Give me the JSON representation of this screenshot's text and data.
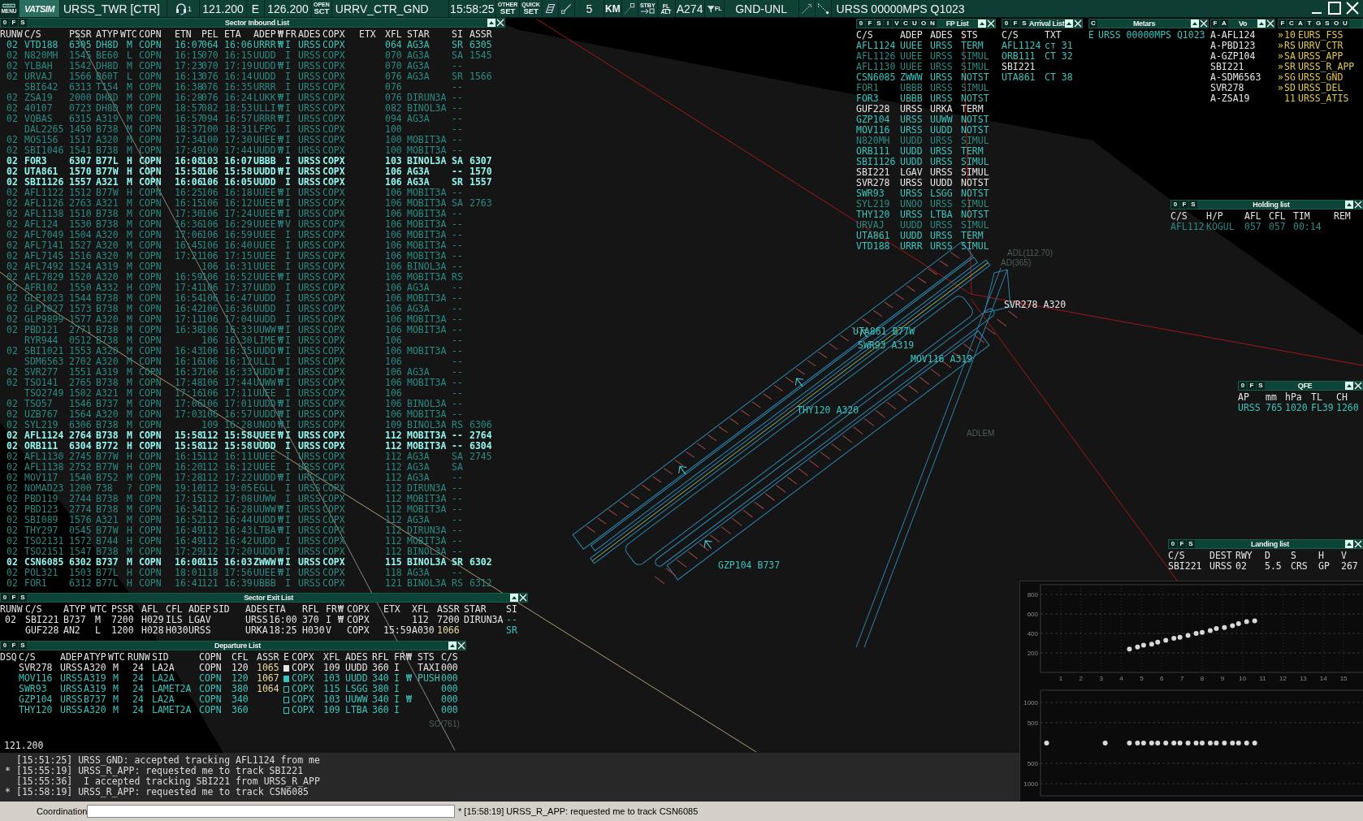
{
  "top_bar": {
    "menu_label": "MENU",
    "logo": "VATSIM",
    "station": "URSS_TWR [CTR]",
    "headset_count": "1",
    "primary_frequency": "121.200",
    "atis_letter": "E",
    "secondary_frequency": "126.200",
    "open_label": "OPEN",
    "sct_label": "SCT",
    "sector": "URRV_CTR_GND",
    "time": "15:58:25",
    "other_label": "OTHER",
    "other_set": "SET",
    "quick_label": "QUICK",
    "quick_set": "SET",
    "range": "5",
    "unit": "KM",
    "stby_label": "STBY",
    "fl_label": "FL",
    "alt_label": "ALT",
    "transition": "A274",
    "filter_label": "FL",
    "altitude_filter": "GND-UNL",
    "metar": "URSS 00000MPS Q1023"
  },
  "inbound_list": {
    "buttons": [
      "0",
      "F",
      "S"
    ],
    "title": "Sector Inbound List",
    "columns": [
      "RUNW",
      "C/S",
      "PSSR",
      "ATYP",
      "WTC",
      "COPN",
      "ETN",
      "PEL",
      "ETA",
      "ADEP",
      "₩",
      "FR",
      "ADES",
      "COPX",
      "ETX",
      "XFL",
      "STAR",
      "SI",
      "ASSR"
    ],
    "rows": [
      {
        "kind": "notified",
        "cells": [
          "02",
          "VTD188",
          "6305",
          "DH8D",
          "M",
          "COPN",
          "16:07",
          "064",
          "16:06",
          "URRR",
          "₩",
          "I",
          "URSS",
          "COPX",
          null,
          "064",
          "AG3A",
          "SR",
          "6305"
        ]
      },
      {
        "kind": "other",
        "cells": [
          "02",
          "N820MH",
          "1545",
          "BE60",
          "L",
          "COPN",
          "16:15",
          "070",
          "16:15",
          "UUDD",
          null,
          "I",
          "URSS",
          "COPX",
          null,
          "070",
          "AG3A",
          "SA",
          "1545"
        ]
      },
      {
        "kind": "other",
        "cells": [
          "02",
          "YLBAH",
          "1542",
          "DH8D",
          "M",
          "COPN",
          "17:23",
          "070",
          "17:19",
          "UUDD",
          "₩",
          "I",
          "URSS",
          "COPX",
          null,
          "070",
          "AG3A",
          "--",
          null
        ]
      },
      {
        "kind": "other",
        "cells": [
          "02",
          "URVAJ",
          "1566",
          "B60T",
          "L",
          "COPN",
          "16:13",
          "076",
          "16:14",
          "UUDD",
          null,
          "I",
          "URSS",
          "COPX",
          null,
          "076",
          "AG3A",
          "SR",
          "1566"
        ]
      },
      {
        "kind": "other",
        "cells": [
          null,
          "SBI642",
          "6313",
          "T154",
          "M",
          "COPN",
          "16:38",
          "076",
          "16:35",
          "URRR",
          null,
          "I",
          "URSS",
          "COPX",
          null,
          "076",
          null,
          "--",
          null
        ]
      },
      {
        "kind": "other",
        "cells": [
          "02",
          "ZSA19",
          "2000",
          "DH8D",
          "M",
          "COPN",
          "16:28",
          "076",
          "16:24",
          "LUKK",
          "₩",
          "I",
          "URSS",
          "COPX",
          null,
          "076",
          "DIRUN3A",
          "--",
          null
        ]
      },
      {
        "kind": "other",
        "cells": [
          "02",
          "40107",
          "0723",
          "DH8D",
          "M",
          "COPN",
          "18:57",
          "082",
          "18:53",
          "ULLI",
          "₩",
          "I",
          "URSS",
          "COPX",
          null,
          "082",
          "BINOL3A",
          "--",
          null
        ]
      },
      {
        "kind": "other",
        "cells": [
          "02",
          "VQBAS",
          "6315",
          "A319",
          "M",
          "COPN",
          "16:57",
          "094",
          "16:57",
          "URRR",
          "₩",
          "I",
          "URSS",
          "COPX",
          null,
          "094",
          "AG3A",
          "--",
          null
        ]
      },
      {
        "kind": "other",
        "cells": [
          null,
          "DAL2265",
          "1450",
          "B738",
          "M",
          "COPN",
          "18:37",
          "100",
          "18:31",
          "LFPG",
          null,
          "I",
          "URSS",
          "COPX",
          null,
          "100",
          null,
          "--",
          null
        ]
      },
      {
        "kind": "other",
        "cells": [
          "02",
          "MOS156",
          "1517",
          "A320",
          "M",
          "COPN",
          "17:34",
          "100",
          "17:30",
          "UUEE",
          "₩",
          "I",
          "URSS",
          "COPX",
          null,
          "100",
          "MOBIT3A",
          "--",
          null
        ]
      },
      {
        "kind": "other",
        "cells": [
          "02",
          "SBI1046",
          "1541",
          "B738",
          "M",
          "COPN",
          "17:49",
          "100",
          "17:44",
          "UUDD",
          "₩",
          "I",
          "URSS",
          "COPX",
          null,
          "100",
          "MOBIT3A",
          "--",
          null
        ]
      },
      {
        "kind": "assumed",
        "cells": [
          "02",
          "FOR3",
          "6307",
          "B77L",
          "H",
          "COPN",
          "16:08",
          "103",
          "16:07",
          "UBBB",
          null,
          "I",
          "URSS",
          "COPX",
          null,
          "103",
          "BINOL3A",
          "SA",
          "6307"
        ]
      },
      {
        "kind": "assumed",
        "cells": [
          "02",
          "UTA861",
          "1570",
          "B77W",
          "H",
          "COPN",
          "15:58",
          "106",
          "15:58",
          "UUDD",
          "₩",
          "I",
          "URSS",
          "COPX",
          null,
          "106",
          "AG3A",
          "--",
          "1570"
        ]
      },
      {
        "kind": "assumed",
        "cells": [
          "02",
          "SBI1126",
          "1557",
          "A321",
          "M",
          "COPN",
          "16:06",
          "106",
          "16:05",
          "UUDD",
          null,
          "I",
          "URSS",
          "COPX",
          null,
          "106",
          "AG3A",
          "SR",
          "1557"
        ]
      },
      {
        "kind": "other",
        "cells": [
          "02",
          "AFL1122",
          "1512",
          "B77W",
          "H",
          "COPN",
          "16:25",
          "106",
          "16:18",
          "UUEE",
          "₩",
          "I",
          "URSS",
          "COPX",
          null,
          "106",
          "MOBIT3A",
          "--",
          null
        ]
      },
      {
        "kind": "other",
        "cells": [
          "02",
          "AFL1126",
          "2763",
          "A321",
          "M",
          "COPN",
          "16:15",
          "106",
          "16:12",
          "UUEE",
          "₩",
          "I",
          "URSS",
          "COPX",
          null,
          "106",
          "MOBIT3A",
          "SA",
          "2763"
        ]
      },
      {
        "kind": "other",
        "cells": [
          "02",
          "AFL1138",
          "1510",
          "B738",
          "M",
          "COPN",
          "17:30",
          "106",
          "17:24",
          "UUEE",
          "₩",
          "I",
          "URSS",
          "COPX",
          null,
          "106",
          "MOBIT3A",
          "--",
          null
        ]
      },
      {
        "kind": "other",
        "cells": [
          "02",
          "AFL124",
          "1530",
          "B738",
          "M",
          "COPN",
          "16:36",
          "106",
          "16:29",
          "UUEE",
          "₩",
          "V",
          "URSS",
          "COPX",
          null,
          "106",
          "MOBIT3A",
          "--",
          null
        ]
      },
      {
        "kind": "other",
        "cells": [
          "02",
          "AFL7049",
          "1504",
          "A320",
          "M",
          "COPN",
          "17:06",
          "106",
          "16:59",
          "UUEE",
          null,
          "I",
          "URSS",
          "COPX",
          null,
          "106",
          "MOBIT3A",
          "--",
          null
        ]
      },
      {
        "kind": "other",
        "cells": [
          "02",
          "AFL7141",
          "1527",
          "A320",
          "M",
          "COPN",
          "16:45",
          "106",
          "16:40",
          "UUEE",
          null,
          "I",
          "URSS",
          "COPX",
          null,
          "106",
          "MOBIT3A",
          "--",
          null
        ]
      },
      {
        "kind": "other",
        "cells": [
          "02",
          "AFL7145",
          "1516",
          "A320",
          "M",
          "COPN",
          "17:21",
          "106",
          "17:15",
          "UUEE",
          null,
          "I",
          "URSS",
          "COPX",
          null,
          "106",
          "MOBIT3A",
          "--",
          null
        ]
      },
      {
        "kind": "other",
        "cells": [
          "02",
          "AFL7492",
          "1524",
          "A319",
          "M",
          "COPN",
          null,
          "106",
          "16:31",
          "UUEE",
          null,
          "I",
          "URSS",
          "COPX",
          null,
          "106",
          "BINOL3A",
          "--",
          null
        ]
      },
      {
        "kind": "other",
        "cells": [
          "02",
          "AFL7829",
          "1520",
          "A320",
          "M",
          "COPN",
          "16:59",
          "106",
          "16:52",
          "UUEE",
          "₩",
          "I",
          "URSS",
          "COPX",
          null,
          "106",
          "MOBIT3A",
          "RS",
          null
        ]
      },
      {
        "kind": "other",
        "cells": [
          "02",
          "AFR102",
          "1550",
          "A332",
          "H",
          "COPN",
          "17:41",
          "106",
          "17:37",
          "UUDD",
          null,
          "I",
          "URSS",
          "COPX",
          null,
          "106",
          "AG3A",
          "--",
          null
        ]
      },
      {
        "kind": "other",
        "cells": [
          "02",
          "GLP1023",
          "1544",
          "B738",
          "M",
          "COPN",
          "16:54",
          "106",
          "16:47",
          "UUDD",
          null,
          "I",
          "URSS",
          "COPX",
          null,
          "106",
          "MOBIT3A",
          "--",
          null
        ]
      },
      {
        "kind": "other",
        "cells": [
          "02",
          "GLP1027",
          "1573",
          "B738",
          "M",
          "COPN",
          "16:42",
          "106",
          "16:36",
          "UUDD",
          null,
          "I",
          "URSS",
          "COPX",
          null,
          "106",
          "AG3A",
          "--",
          null
        ]
      },
      {
        "kind": "other",
        "cells": [
          "02",
          "GLP9899",
          "1577",
          "A320",
          "M",
          "COPN",
          "17:11",
          "106",
          "17:04",
          "UUDD",
          null,
          "I",
          "URSS",
          "COPX",
          null,
          "106",
          "MOBIT3A",
          "--",
          null
        ]
      },
      {
        "kind": "other",
        "cells": [
          "02",
          "PBD121",
          "2771",
          "B738",
          "M",
          "COPN",
          "16:38",
          "106",
          "16:33",
          "UUWW",
          "₩",
          "I",
          "URSS",
          "COPX",
          null,
          "106",
          "MOBIT3A",
          "--",
          null
        ]
      },
      {
        "kind": "other",
        "cells": [
          null,
          "RYR944",
          "0512",
          "B738",
          "M",
          "COPN",
          null,
          "106",
          "16:30",
          "LIME",
          "₩",
          "I",
          "URSS",
          "COPX",
          null,
          "106",
          null,
          "--",
          null
        ]
      },
      {
        "kind": "other",
        "cells": [
          "02",
          "SBI1021",
          "1553",
          "A320",
          "M",
          "COPN",
          "16:43",
          "106",
          "16:35",
          "UUDD",
          "₩",
          "I",
          "URSS",
          "COPX",
          null,
          "106",
          "MOBIT3A",
          "--",
          null
        ]
      },
      {
        "kind": "other",
        "cells": [
          null,
          "SDM6563",
          "2702",
          "A320",
          "M",
          "COPN",
          "16:16",
          "106",
          "16:12",
          "ULLI",
          null,
          "I",
          "URSS",
          "COPX",
          null,
          "106",
          null,
          "--",
          null
        ]
      },
      {
        "kind": "other",
        "cells": [
          "02",
          "SVR277",
          "1551",
          "A319",
          "M",
          "COPN",
          "16:37",
          "106",
          "16:33",
          "UUDD",
          "₩",
          "I",
          "URSS",
          "COPX",
          null,
          "106",
          "AG3A",
          "--",
          null
        ]
      },
      {
        "kind": "other",
        "cells": [
          "02",
          "TSO141",
          "2765",
          "B738",
          "M",
          "COPN",
          "17:48",
          "106",
          "17:44",
          "UUWW",
          "₩",
          "I",
          "URSS",
          "COPX",
          null,
          "106",
          "MOBIT3A",
          "--",
          null
        ]
      },
      {
        "kind": "other",
        "cells": [
          null,
          "TSO2749",
          "1502",
          "A321",
          "M",
          "COPN",
          "17:16",
          "106",
          "17:11",
          "UUEE",
          null,
          "I",
          "URSS",
          "COPX",
          null,
          "106",
          null,
          "--",
          null
        ]
      },
      {
        "kind": "other",
        "cells": [
          "02",
          "TSO57",
          "1546",
          "B737",
          "M",
          "COPN",
          "17:06",
          "106",
          "17:01",
          "UUDD",
          "₩",
          "I",
          "URSS",
          "COPX",
          null,
          "106",
          "BINOL3A",
          "--",
          null
        ]
      },
      {
        "kind": "other",
        "cells": [
          "02",
          "UZB767",
          "1564",
          "A320",
          "M",
          "COPN",
          "17:03",
          "106",
          "16:57",
          "UUDD",
          "₩",
          "I",
          "URSS",
          "COPX",
          null,
          "106",
          "MOBIT3A",
          "--",
          null
        ]
      },
      {
        "kind": "other",
        "cells": [
          "02",
          "SYL219",
          "6306",
          "B738",
          "M",
          "COPN",
          null,
          "109",
          "16:28",
          "UNOO",
          "₩",
          "I",
          "URSS",
          "COPX",
          null,
          "109",
          "BINOL3A",
          "RS",
          "6306"
        ]
      },
      {
        "kind": "assumed",
        "cells": [
          "02",
          "AFL1124",
          "2764",
          "B738",
          "M",
          "COPN",
          "15:58",
          "112",
          "15:58",
          "UUEE",
          "₩",
          "I",
          "URSS",
          "COPX",
          null,
          "112",
          "MOBIT3A",
          "--",
          "2764"
        ]
      },
      {
        "kind": "assumed",
        "cells": [
          "02",
          "ORB111",
          "6304",
          "B772",
          "H",
          "COPN",
          "15:58",
          "112",
          "15:58",
          "UUDD",
          null,
          "I",
          "URSS",
          "COPX",
          null,
          "112",
          "MOBIT3A",
          "--",
          "6304"
        ]
      },
      {
        "kind": "other",
        "cells": [
          "02",
          "AFL1130",
          "2745",
          "B77W",
          "H",
          "COPN",
          "16:15",
          "112",
          "16:11",
          "UUEE",
          null,
          "I",
          "URSS",
          "COPX",
          null,
          "112",
          "AG3A",
          "SA",
          "2745"
        ]
      },
      {
        "kind": "other",
        "cells": [
          "02",
          "AFL1138",
          "2752",
          "B77W",
          "H",
          "COPN",
          "16:20",
          "112",
          "16:12",
          "UUEE",
          null,
          "I",
          "URSS",
          "COPX",
          null,
          "112",
          "AG3A",
          "SA",
          null
        ]
      },
      {
        "kind": "other",
        "cells": [
          "02",
          "MOV117",
          "1540",
          "B752",
          "M",
          "COPN",
          "17:28",
          "112",
          "17:22",
          "UUDD",
          "₩",
          "I",
          "URSS",
          "COPX",
          null,
          "112",
          "AG3A",
          "--",
          null
        ]
      },
      {
        "kind": "other",
        "cells": [
          "02",
          "NOMAD23",
          "1200",
          "738",
          "?",
          "COPN",
          "19:10",
          "112",
          "19:05",
          "EGLL",
          null,
          "I",
          "URSS",
          "COPX",
          null,
          "112",
          "DIRUN3A",
          "--",
          null
        ]
      },
      {
        "kind": "other",
        "cells": [
          "02",
          "PBD119",
          "2744",
          "B738",
          "M",
          "COPN",
          "17:15",
          "112",
          "17:08",
          "UUWW",
          null,
          "I",
          "URSS",
          "COPX",
          null,
          "112",
          "MOBIT3A",
          "--",
          null
        ]
      },
      {
        "kind": "other",
        "cells": [
          "02",
          "PBD123",
          "2774",
          "B738",
          "M",
          "COPN",
          "16:34",
          "112",
          "16:28",
          "UUWW",
          "₩",
          "I",
          "URSS",
          "COPX",
          null,
          "112",
          "MOBIT3A",
          "--",
          null
        ]
      },
      {
        "kind": "other",
        "cells": [
          "02",
          "SBI089",
          "1576",
          "A321",
          "M",
          "COPN",
          "16:52",
          "112",
          "16:44",
          "UUDD",
          "₩",
          "I",
          "URSS",
          "COPX",
          null,
          "112",
          "AG3A",
          "--",
          null
        ]
      },
      {
        "kind": "other",
        "cells": [
          "02",
          "THY297",
          "0545",
          "B77W",
          "H",
          "COPN",
          "16:49",
          "112",
          "16:43",
          "LTBA",
          "₩",
          "I",
          "URSS",
          "COPX",
          null,
          "112",
          "DIRUN3A",
          "--",
          null
        ]
      },
      {
        "kind": "other",
        "cells": [
          "02",
          "TSO2131",
          "1572",
          "B744",
          "H",
          "COPN",
          "16:49",
          "112",
          "16:42",
          "UUDD",
          null,
          "I",
          "URSS",
          "COPX",
          null,
          "112",
          "MOBIT3A",
          "--",
          null
        ]
      },
      {
        "kind": "other",
        "cells": [
          "02",
          "TSO2151",
          "1547",
          "B738",
          "M",
          "COPN",
          "17:29",
          "112",
          "17:20",
          "UUDD",
          "₩",
          "I",
          "URSS",
          "COPX",
          null,
          "112",
          "BINOL3A",
          "--",
          null
        ]
      },
      {
        "kind": "assumed",
        "cells": [
          "02",
          "CSN6085",
          "6302",
          "B737",
          "M",
          "COPN",
          "16:00",
          "115",
          "16:03",
          "ZWWW",
          "₩",
          "I",
          "URSS",
          "COPX",
          null,
          "115",
          "BINOL3A",
          "SR",
          "6302"
        ]
      },
      {
        "kind": "other",
        "cells": [
          "02",
          "POL321",
          "1503",
          "B77L",
          "H",
          "COPN",
          "18:01",
          "118",
          "17:56",
          "UUEE",
          "₩",
          "I",
          "URSS",
          "COPX",
          null,
          "118",
          "AG3A",
          "--",
          null
        ]
      },
      {
        "kind": "other",
        "cells": [
          "02",
          "FOR1",
          "6312",
          "B77L",
          "H",
          "COPN",
          "16:41",
          "121",
          "16:39",
          "UBBB",
          null,
          "I",
          "URSS",
          "COPX",
          null,
          "121",
          "BINOL3A",
          "RS",
          "6312"
        ]
      }
    ]
  },
  "exit_list": {
    "buttons": [
      "0",
      "F",
      "S"
    ],
    "title": "Sector Exit List",
    "columns": [
      "RUNW",
      "C/S",
      "ATYP",
      "WTC",
      "PSSR",
      "AFL",
      "CFL",
      "ADEP",
      "SID",
      "ADES",
      "ETA",
      "RFL",
      "FR",
      "₩",
      "COPX",
      "ETX",
      "XFL",
      "ASSR",
      "STAR",
      "SI"
    ],
    "rows": [
      {
        "kind": "own",
        "assr_flag": false,
        "cells": [
          "02",
          "SBI221",
          "B737",
          "M",
          "7200",
          "H029",
          "ILS",
          "LGAV",
          null,
          "URSS",
          "16:00",
          "370",
          "I",
          "₩",
          "COPX",
          null,
          "112",
          "7200",
          "DIRUN3A",
          "--"
        ]
      },
      {
        "kind": "own",
        "assr_flag": true,
        "cells": [
          null,
          "GUF228",
          "AN2",
          "L",
          "1200",
          "H028",
          "H030",
          "URSS",
          null,
          "URKA",
          "18:25",
          "H030",
          "V",
          null,
          "COPX",
          "15:59",
          "A030",
          "1066",
          null,
          "SR"
        ]
      }
    ]
  },
  "departure_list": {
    "buttons": [
      "0",
      "F",
      "S"
    ],
    "title": "Departure List",
    "columns": [
      "DSQ",
      "C/S",
      "ADEP",
      "ATYP",
      "WTC",
      "RUNW",
      "SID",
      "COPN",
      "CFL",
      "ASSR",
      "E",
      "COPX",
      "XFL",
      "ADES",
      "RFL",
      "FR",
      "₩",
      "STS",
      "C/S"
    ],
    "rows": [
      {
        "kind": "own",
        "assr_flag": true,
        "e_checked": true,
        "cells": [
          null,
          "SVR278",
          "URSS",
          "A320",
          "M",
          "24",
          "LA2A",
          "COPN",
          "120",
          "1065",
          null,
          "COPX",
          "109",
          "UUDD",
          "360",
          "I",
          null,
          "TAXI",
          "000"
        ]
      },
      {
        "kind": "notified",
        "assr_flag": true,
        "e_checked": true,
        "cells": [
          null,
          "MOV116",
          "URSS",
          "A319",
          "M",
          "24",
          "LA2A",
          "COPN",
          "120",
          "1067",
          null,
          "COPX",
          "103",
          "UUDD",
          "340",
          "I",
          "₩",
          "PUSH",
          "000"
        ]
      },
      {
        "kind": "notified",
        "assr_flag": true,
        "e_checked": false,
        "cells": [
          null,
          "SWR93",
          "URSS",
          "A319",
          "M",
          "24",
          "LAMET2A",
          "COPN",
          "380",
          "1064",
          null,
          "COPX",
          "115",
          "LSGG",
          "380",
          "I",
          null,
          null,
          "000"
        ]
      },
      {
        "kind": "notified",
        "e_checked": false,
        "cells": [
          null,
          "GZP104",
          "URSS",
          "B737",
          "M",
          "24",
          "LA2A",
          "COPN",
          "340",
          null,
          null,
          "COPX",
          "103",
          "UUWW",
          "340",
          "I",
          "₩",
          null,
          "000"
        ]
      },
      {
        "kind": "notified",
        "e_checked": false,
        "cells": [
          null,
          "THY120",
          "URSS",
          "A320",
          "M",
          "24",
          "LAMET2A",
          "COPN",
          "360",
          null,
          null,
          "COPX",
          "109",
          "LTBA",
          "360",
          "I",
          null,
          null,
          "000"
        ]
      }
    ]
  },
  "fp_list": {
    "buttons": [
      "0",
      "F",
      "S",
      "I",
      "V",
      "C",
      "U",
      "O",
      "N"
    ],
    "title": "FP List",
    "columns": [
      "C/S",
      "ADEP",
      "ADES",
      "STS"
    ],
    "rows": [
      {
        "kind": "notified",
        "cells": [
          "AFL1124",
          "UUEE",
          "URSS",
          "TERM"
        ]
      },
      {
        "kind": "other",
        "cells": [
          "AFL1126",
          "UUEE",
          "URSS",
          "SIMUL"
        ]
      },
      {
        "kind": "other",
        "cells": [
          "AFL1130",
          "UUEE",
          "URSS",
          "SIMUL"
        ]
      },
      {
        "kind": "notified",
        "cells": [
          "CSN6085",
          "ZWWW",
          "URSS",
          "NOTST"
        ]
      },
      {
        "kind": "other",
        "cells": [
          "FOR1",
          "UBBB",
          "URSS",
          "SIMUL"
        ]
      },
      {
        "kind": "notified",
        "cells": [
          "FOR3",
          "UBBB",
          "URSS",
          "NOTST"
        ]
      },
      {
        "kind": "own",
        "cells": [
          "GUF228",
          "URSS",
          "URKA",
          "TERM"
        ]
      },
      {
        "kind": "notified",
        "cells": [
          "GZP104",
          "URSS",
          "UUWW",
          "NOTST"
        ]
      },
      {
        "kind": "notified",
        "cells": [
          "MOV116",
          "URSS",
          "UUDD",
          "NOTST"
        ]
      },
      {
        "kind": "other",
        "cells": [
          "N820MH",
          "UUDD",
          "URSS",
          "SIMUL"
        ]
      },
      {
        "kind": "notified",
        "cells": [
          "ORB111",
          "UUDD",
          "URSS",
          "TERM"
        ]
      },
      {
        "kind": "notified",
        "cells": [
          "SBI1126",
          "UUDD",
          "URSS",
          "SIMUL"
        ]
      },
      {
        "kind": "own",
        "cells": [
          "SBI221",
          "LGAV",
          "URSS",
          "SIMUL"
        ]
      },
      {
        "kind": "own",
        "cells": [
          "SVR278",
          "URSS",
          "UUDD",
          "NOTST"
        ]
      },
      {
        "kind": "notified",
        "cells": [
          "SWR93",
          "URSS",
          "LSGG",
          "NOTST"
        ]
      },
      {
        "kind": "other",
        "cells": [
          "SYL219",
          "UNOO",
          "URSS",
          "SIMUL"
        ]
      },
      {
        "kind": "notified",
        "cells": [
          "THY120",
          "URSS",
          "LTBA",
          "NOTST"
        ]
      },
      {
        "kind": "other",
        "cells": [
          "URVAJ",
          "UUDD",
          "URSS",
          "SIMUL"
        ]
      },
      {
        "kind": "notified",
        "cells": [
          "UTA861",
          "UUDD",
          "URSS",
          "TERM"
        ]
      },
      {
        "kind": "notified",
        "cells": [
          "VTD188",
          "URRR",
          "URSS",
          "SIMUL"
        ]
      }
    ]
  },
  "arrival_list": {
    "buttons": [
      "0",
      "F",
      "S"
    ],
    "title": "Arrival List",
    "columns": [
      "C/S",
      "TXT"
    ],
    "rows": [
      {
        "kind": "notified",
        "cells": [
          "AFL1124",
          "ст 31"
        ]
      },
      {
        "kind": "notified",
        "cells": [
          "ORB111",
          "CT 32"
        ]
      },
      {
        "kind": "own",
        "cells": [
          "SBI221",
          null
        ]
      },
      {
        "kind": "notified",
        "cells": [
          "UTA861",
          "CT 38"
        ]
      }
    ]
  },
  "metar_list": {
    "buttons": [
      "C"
    ],
    "title": "Metars",
    "rows": [
      {
        "kind": "notified",
        "cells": [
          "E",
          "URSS 00000MPS Q1023"
        ]
      }
    ]
  },
  "voice_list": {
    "buttons": [
      "F",
      "A"
    ],
    "title": "Vo",
    "rows": [
      {
        "kind": "own",
        "cells": [
          "A-AFL124"
        ]
      },
      {
        "kind": "own",
        "cells": [
          "A-PBD123"
        ]
      },
      {
        "kind": "own",
        "cells": [
          "A-GZP104"
        ]
      },
      {
        "kind": "own",
        "cells": [
          "SBI221"
        ]
      },
      {
        "kind": "own",
        "cells": [
          "A-SDM6563"
        ]
      },
      {
        "kind": "own",
        "cells": [
          "SVR278"
        ]
      },
      {
        "kind": "own",
        "cells": [
          "A-ZSA19"
        ]
      }
    ]
  },
  "controller_list": {
    "buttons": [
      "F",
      "C",
      "A",
      "T",
      "G",
      "S",
      "O",
      "U"
    ],
    "rows": [
      {
        "kind": "controller",
        "cells": [
          "»",
          "10",
          "EURS_FSS"
        ]
      },
      {
        "kind": "controller",
        "cells": [
          "»",
          "RS",
          "URRV_CTR"
        ]
      },
      {
        "kind": "controller",
        "cells": [
          "»",
          "SA",
          "URSS_APP"
        ]
      },
      {
        "kind": "controller",
        "cells": [
          "»",
          "SR",
          "URSS_R_APP"
        ]
      },
      {
        "kind": "controller",
        "cells": [
          "»",
          "SG",
          "URSS_GND"
        ]
      },
      {
        "kind": "controller",
        "cells": [
          "»",
          "SD",
          "URSS_DEL"
        ]
      },
      {
        "kind": "controller",
        "cells": [
          null,
          "11",
          "URSS_ATIS"
        ]
      }
    ]
  },
  "holding_list": {
    "buttons": [
      "0",
      "F",
      "S"
    ],
    "title": "Holding list",
    "columns": [
      "C/S",
      "H/P",
      "AFL",
      "CFL",
      "TIM",
      "REM"
    ],
    "rows": [
      {
        "kind": "other",
        "cells": [
          "AFL112",
          "KOGUL",
          "057",
          "057",
          "00:14",
          null
        ]
      }
    ]
  },
  "qfe_list": {
    "buttons": [
      "0",
      "F",
      "S"
    ],
    "title": "QFE",
    "columns": [
      "AP",
      "mm",
      "hPa",
      "TL",
      "CH"
    ],
    "rows": [
      {
        "kind": "notified",
        "cells": [
          "URSS",
          "765",
          "1020",
          "FL39",
          "1260"
        ]
      }
    ]
  },
  "landing_list": {
    "buttons": [
      "0",
      "F",
      "S"
    ],
    "title": "Landing list",
    "columns": [
      "C/S",
      "DEST",
      "RWY",
      "D",
      "S",
      "H",
      "V"
    ],
    "rows": [
      {
        "kind": "own",
        "cells": [
          "SBI221",
          "URSS",
          "02",
          "5.5",
          "CRS",
          "GP",
          "267"
        ]
      }
    ]
  },
  "radar": {
    "aircraft_labels": [
      {
        "kind": "own",
        "text": "SVR278 A320"
      },
      {
        "kind": "notified",
        "text": "UTA861 B77W"
      },
      {
        "kind": "notified",
        "text": "SWR93 A319"
      },
      {
        "kind": "notified",
        "text": "MOV116 A319"
      },
      {
        "kind": "notified",
        "text": "THY120 A320"
      },
      {
        "kind": "notified",
        "text": "GZP104 B737"
      }
    ],
    "navaid_labels": [
      "ADL(112.70)",
      "AD(365)",
      "ADLEM",
      "SO(761)"
    ],
    "frequency": "121.200"
  },
  "vertical_profile": {
    "chart_data": {
      "type": "scatter",
      "x": [
        4.4,
        4.8,
        5.1,
        5.5,
        5.8,
        6.2,
        6.6,
        6.9,
        7.3,
        7.7,
        8.0,
        8.4,
        8.7,
        9.1,
        9.5,
        9.8,
        10.2,
        10.6
      ],
      "series": [
        {
          "color": "#d8d8d8",
          "values": [
            240,
            260,
            280,
            290,
            310,
            330,
            350,
            360,
            380,
            400,
            410,
            430,
            450,
            460,
            480,
            500,
            520,
            530
          ]
        }
      ],
      "xlim": [
        0,
        16
      ],
      "ylim": [
        0,
        900
      ],
      "xticks": [
        1,
        2,
        3,
        4,
        5,
        6,
        7,
        8,
        9,
        10,
        11,
        12,
        13,
        14,
        15
      ],
      "yticks": [
        200,
        400,
        600,
        800
      ],
      "grid": true
    }
  },
  "lateral_profile": {
    "chart_data": {
      "type": "scatter",
      "x": [
        0.3,
        3.2,
        4.4,
        4.8,
        5.1,
        5.5,
        5.8,
        6.2,
        6.6,
        6.9,
        7.3,
        7.7,
        8.0,
        8.4,
        8.7,
        9.1,
        9.5,
        9.8,
        10.2,
        10.6
      ],
      "series": [
        {
          "color": "#d8d8d8",
          "values": [
            0,
            0,
            0,
            0,
            0,
            0,
            0,
            0,
            0,
            0,
            0,
            0,
            0,
            0,
            0,
            0,
            0,
            0,
            0,
            0
          ]
        }
      ],
      "xlim": [
        0,
        16
      ],
      "ylim": [
        -1300,
        1300
      ],
      "grid": true,
      "yticks": [
        {
          "value": 1000,
          "label": "1000"
        },
        {
          "value": 500,
          "label": "500"
        },
        {
          "value": -500,
          "label": "500"
        },
        {
          "value": -1000,
          "label": "1000"
        }
      ]
    }
  },
  "messages": [
    {
      "text": "[15:51:25] URSS_GND: accepted tracking AFL1124 from me"
    },
    {
      "marker": "*",
      "text": "[15:55:19] URSS_R_APP: requested me to track SBI221"
    },
    {
      "text": "[15:55:36]  I accepted tracking SBI221 from URSS_R_APP"
    },
    {
      "marker": "*",
      "text": "[15:58:19] URSS_R_APP: requested me to track CSN6085"
    }
  ],
  "coordination": {
    "label": "Coordination",
    "last_message": "* [15:58:19] URSS_R_APP: requested me to track CSN6085"
  }
}
